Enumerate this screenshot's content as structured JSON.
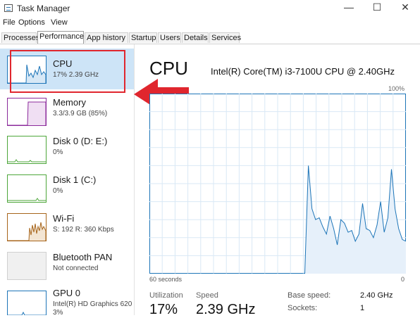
{
  "window": {
    "title": "Task Manager",
    "minimize": "—",
    "maximize": "☐",
    "close": "✕"
  },
  "menu": [
    "File",
    "Options",
    "View"
  ],
  "tabs": [
    "Processes",
    "Performance",
    "App history",
    "Startup",
    "Users",
    "Details",
    "Services"
  ],
  "active_tab": "Performance",
  "sidebar": {
    "items": [
      {
        "name": "CPU",
        "sub": "17%  2.39 GHz",
        "color": "#1d75b8"
      },
      {
        "name": "Memory",
        "sub": "3.3/3.9 GB (85%)",
        "color": "#8b2a9b"
      },
      {
        "name": "Disk 0 (D: E:)",
        "sub": "0%",
        "color": "#4da63a"
      },
      {
        "name": "Disk 1 (C:)",
        "sub": "0%",
        "color": "#4da63a"
      },
      {
        "name": "Wi-Fi",
        "sub": "S: 192  R: 360 Kbps",
        "color": "#a7651b"
      },
      {
        "name": "Bluetooth PAN",
        "sub": "Not connected",
        "color": "#a7651b"
      },
      {
        "name": "GPU 0",
        "sub": "Intel(R) HD Graphics 620",
        "sub2": "3%",
        "color": "#1d75b8"
      }
    ]
  },
  "main": {
    "title": "CPU",
    "model": "Intel(R) Core(TM) i3-7100U CPU @ 2.40GHz",
    "max_label": "100%",
    "time_label": "60 seconds",
    "min_label": "0",
    "stats": [
      {
        "label": "Utilization",
        "value": "17%"
      },
      {
        "label": "Speed",
        "value": "2.39 GHz"
      }
    ],
    "specs": [
      {
        "label": "Base speed:",
        "value": "2.40 GHz"
      },
      {
        "label": "Sockets:",
        "value": "1"
      }
    ]
  },
  "cpu_history": [
    0,
    0,
    0,
    0,
    0,
    0,
    0,
    0,
    0,
    0,
    0,
    0,
    0,
    0,
    0,
    0,
    0,
    0,
    0,
    0,
    0,
    0,
    0,
    0,
    0,
    0,
    0,
    0,
    0,
    0,
    0,
    0,
    0,
    0,
    0,
    0,
    0,
    0,
    0,
    0,
    0,
    0,
    0,
    0,
    60,
    36,
    30,
    31,
    26,
    22,
    32,
    25,
    16,
    30,
    28,
    23,
    24,
    18,
    22,
    39,
    25,
    24,
    20,
    27,
    40,
    23,
    31,
    58,
    36,
    25,
    19,
    18
  ],
  "accent_color": "#1d75b8",
  "annotation_color": "#e0262e"
}
